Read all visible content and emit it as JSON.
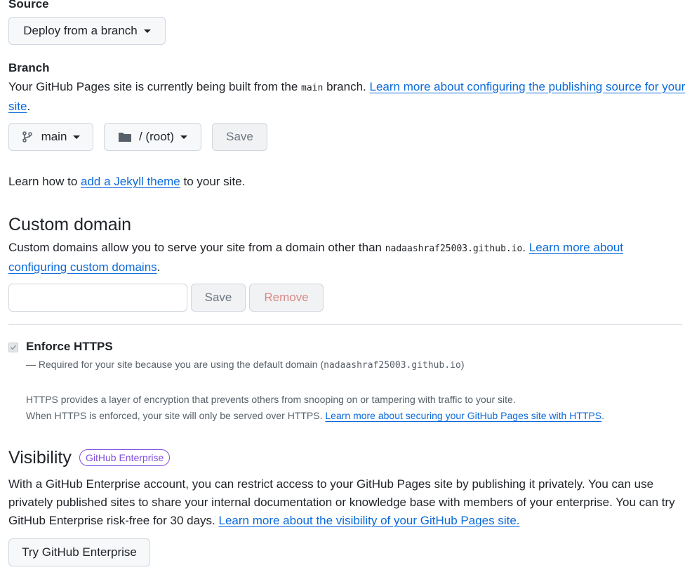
{
  "source": {
    "label": "Source",
    "dropdown": "Deploy from a branch"
  },
  "branch": {
    "label": "Branch",
    "desc_pre": "Your GitHub Pages site is currently being built from the ",
    "desc_code": "main",
    "desc_mid": " branch. ",
    "desc_link": "Learn more about configuring the publishing source for your site",
    "desc_end": ".",
    "branch_select": "main",
    "folder_select": "/ (root)",
    "save": "Save"
  },
  "jekyll": {
    "pre": "Learn how to ",
    "link": "add a Jekyll theme",
    "post": " to your site."
  },
  "custom_domain": {
    "heading": "Custom domain",
    "desc_pre": "Custom domains allow you to serve your site from a domain other than ",
    "desc_code": "nadaashraf25003.github.io",
    "desc_mid": ". ",
    "desc_link": "Learn more about configuring custom domains",
    "desc_end": ".",
    "input_value": "",
    "save": "Save",
    "remove": "Remove"
  },
  "https": {
    "label": "Enforce HTTPS",
    "checked": true,
    "required_pre": "— Required for your site because you are using the default domain (",
    "required_code": "nadaashraf25003.github.io",
    "required_post": ")",
    "info1": "HTTPS provides a layer of encryption that prevents others from snooping on or tampering with traffic to your site.",
    "info2_pre": "When HTTPS is enforced, your site will only be served over HTTPS. ",
    "info2_link": "Learn more about securing your GitHub Pages site with HTTPS",
    "info2_end": "."
  },
  "visibility": {
    "heading": "Visibility",
    "badge": "GitHub Enterprise",
    "desc": "With a GitHub Enterprise account, you can restrict access to your GitHub Pages site by publishing it privately. You can use privately published sites to share your internal documentation or knowledge base with members of your enterprise. You can try GitHub Enterprise risk-free for 30 days. ",
    "desc_link": "Learn more about the visibility of your GitHub Pages site.",
    "button": "Try GitHub Enterprise"
  },
  "colors": {
    "link": "#0969da",
    "badge": "#8250df",
    "border": "#d0d7de",
    "button_bg": "#f6f8fa"
  },
  "icons": [
    "caret-down-icon",
    "git-branch-icon",
    "folder-icon",
    "checkbox-icon"
  ]
}
